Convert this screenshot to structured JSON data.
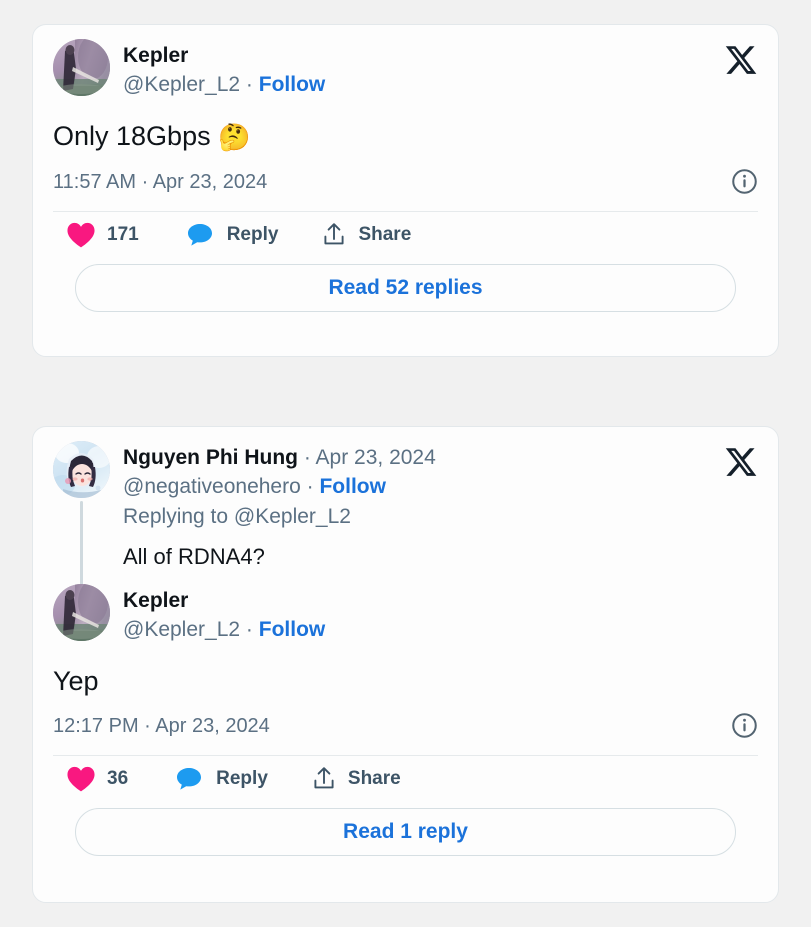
{
  "page": {
    "background_color": "#F1F1F1",
    "card_background": "#FDFDFD",
    "accent_blue": "#1B72DA",
    "like_pink": "#F91880",
    "reply_blue": "#1D9BF0",
    "muted_text": "#5B7083",
    "primary_text": "#0F1419"
  },
  "cards": [
    {
      "id": "tweet-card-1",
      "author": {
        "display_name": "Kepler",
        "handle": "@Kepler_L2",
        "separator": "·",
        "follow_label": "Follow",
        "avatar_name": "kepler-avatar"
      },
      "body_text": "Only 18Gbps ",
      "body_emoji": "🤔",
      "timestamp": "11:57 AM · Apr 23, 2024",
      "info_icon": "info-circle-icon",
      "x_logo": "x-logo-icon",
      "actions": {
        "like_icon": "heart-icon",
        "like_count": "171",
        "reply_icon": "speech-bubble-icon",
        "reply_label": "Reply",
        "share_icon": "share-arrow-icon",
        "share_label": "Share"
      },
      "read_replies_label": "Read 52 replies"
    },
    {
      "id": "tweet-card-2",
      "reply_author": {
        "display_name": "Nguyen Phi Hung",
        "separator": "·",
        "date": "Apr 23, 2024",
        "handle": "@negativeonehero",
        "follow_label": "Follow",
        "replying_to": "Replying to @Kepler_L2",
        "avatar_name": "nguyen-phi-hung-avatar"
      },
      "reply_text": "All of RDNA4?",
      "author": {
        "display_name": "Kepler",
        "handle": "@Kepler_L2",
        "separator": "·",
        "follow_label": "Follow",
        "avatar_name": "kepler-avatar"
      },
      "body_text": "Yep",
      "timestamp": "12:17 PM · Apr 23, 2024",
      "info_icon": "info-circle-icon",
      "x_logo": "x-logo-icon",
      "actions": {
        "like_icon": "heart-icon",
        "like_count": "36",
        "reply_icon": "speech-bubble-icon",
        "reply_label": "Reply",
        "share_icon": "share-arrow-icon",
        "share_label": "Share"
      },
      "read_replies_label": "Read 1 reply"
    }
  ]
}
